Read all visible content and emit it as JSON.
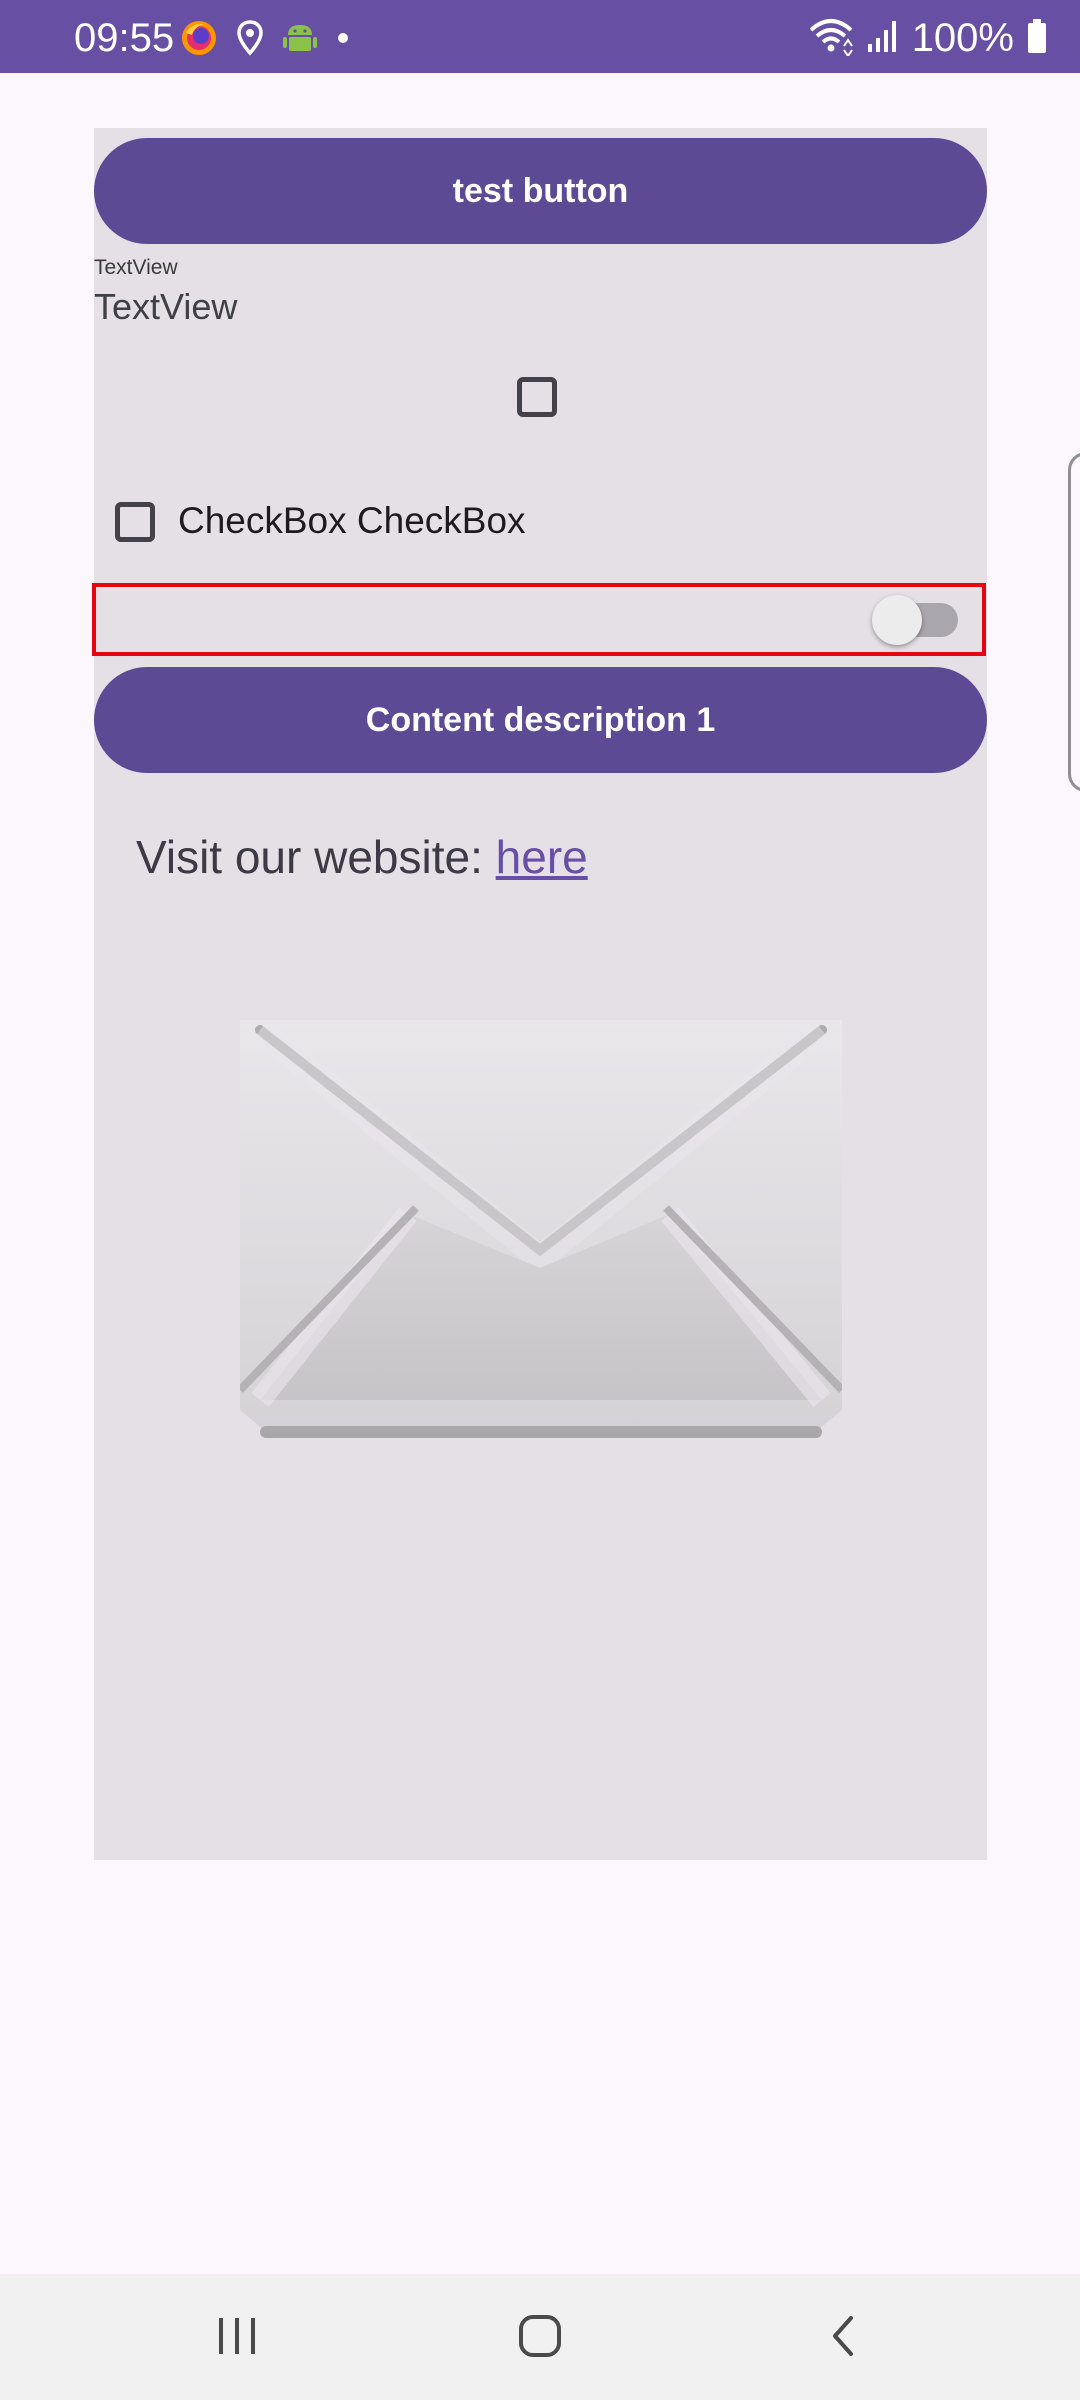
{
  "status_bar": {
    "time": "09:55",
    "battery": "100%",
    "icons": [
      "firefox-icon",
      "location-icon",
      "android-icon",
      "dot-icon",
      "wifi-icon",
      "signal-icon",
      "battery-icon"
    ],
    "background": "#6750A4"
  },
  "main": {
    "test_button_label": "test button",
    "textview_small": "TextView",
    "textview_large": "TextView",
    "checkbox_label": "CheckBox CheckBox",
    "content_button_label": "Content description 1",
    "visit_prefix": "Visit our website: ",
    "visit_link": "here",
    "image_icon": "envelope-icon"
  },
  "colors": {
    "accent": "#6750A4",
    "button": "#5D4A94",
    "panel": "#E5DFE6",
    "page": "#FCF6FD",
    "highlight": "#E30613"
  },
  "navigation": {
    "icons": [
      "recent-apps-icon",
      "home-icon",
      "back-icon"
    ]
  }
}
